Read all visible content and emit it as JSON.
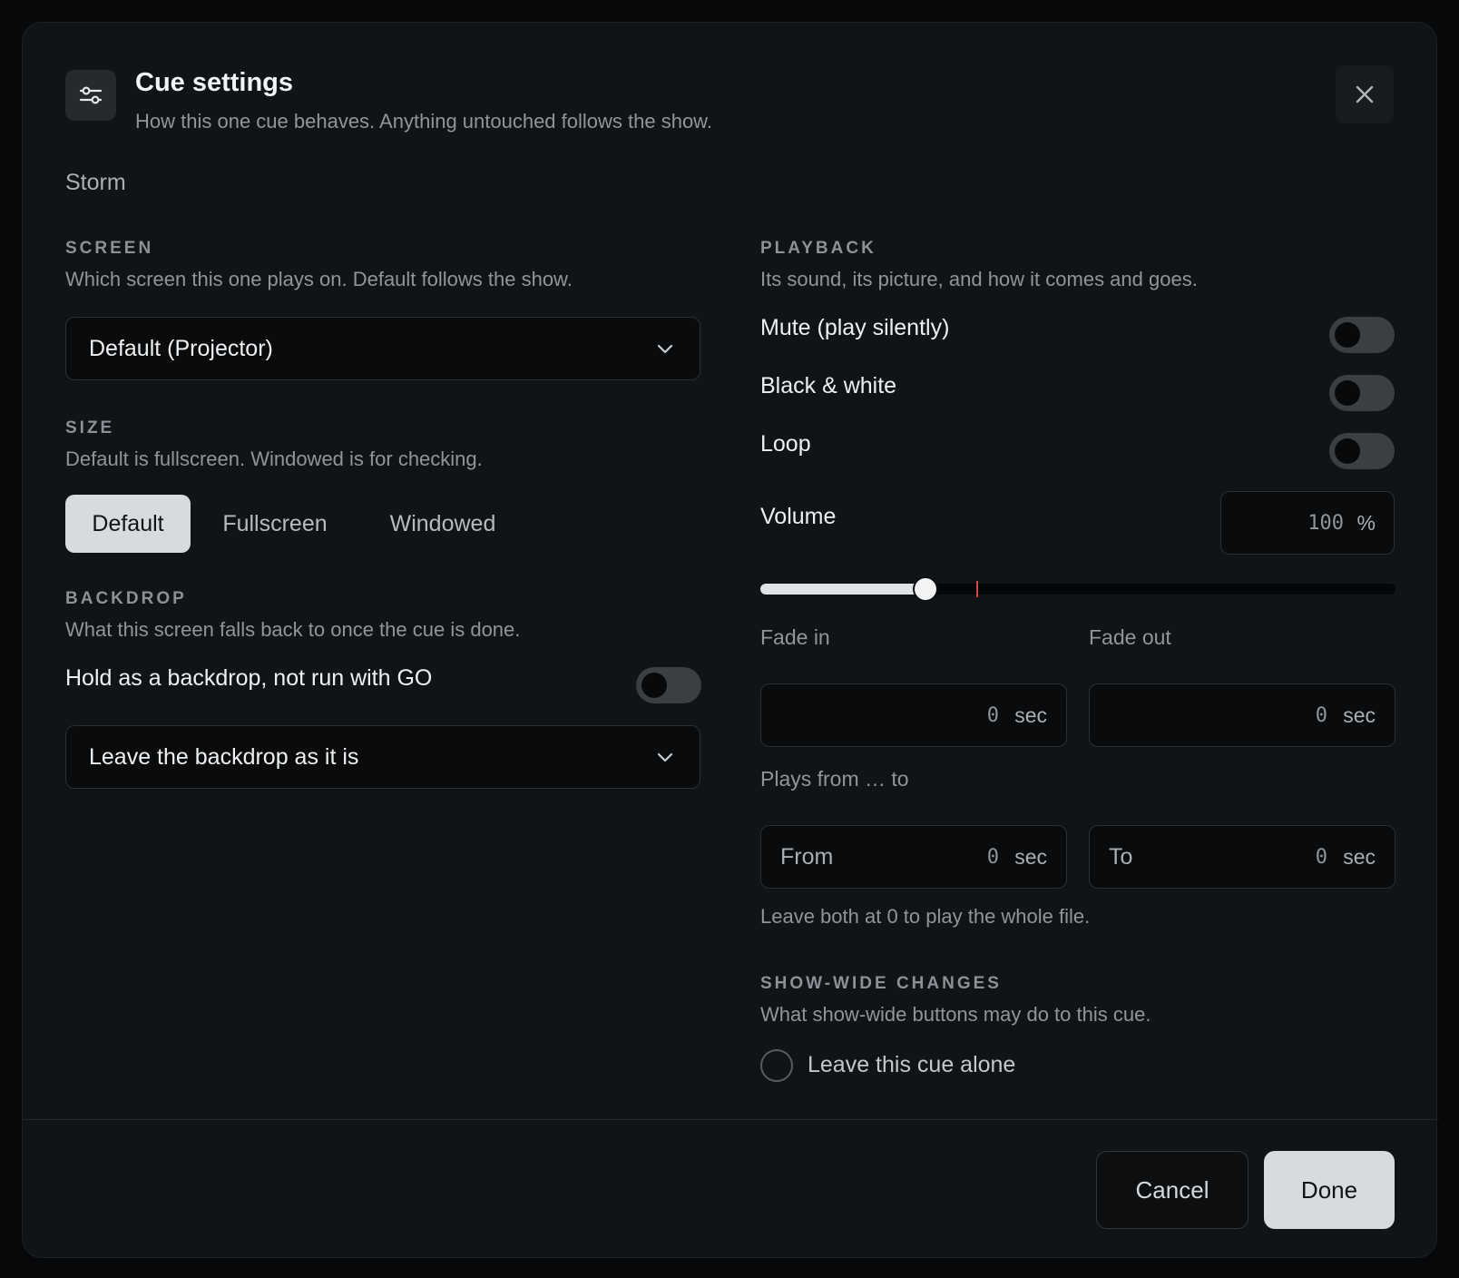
{
  "dialog": {
    "title": "Cue settings",
    "subtitle": "How this one cue behaves. Anything untouched follows the show.",
    "header_icon": "sliders-icon",
    "close_icon": "close-icon"
  },
  "cue_name": "Storm",
  "screen": {
    "label": "SCREEN",
    "help": "Which screen this one plays on. Default follows the show.",
    "selected": "Default (Projector)"
  },
  "size": {
    "label": "SIZE",
    "help": "Default is fullscreen. Windowed is for checking.",
    "options": [
      "Default",
      "Fullscreen",
      "Windowed"
    ],
    "selected": "Default"
  },
  "backdrop": {
    "label": "BACKDROP",
    "help": "What this screen falls back to once the cue is done.",
    "hold_label": "Hold as a backdrop, not run with GO",
    "hold_on": false,
    "selected": "Leave the backdrop as it is"
  },
  "playback": {
    "label": "PLAYBACK",
    "help": "Its sound, its picture, and how it comes and goes.",
    "mute_label": "Mute (play silently)",
    "mute_on": false,
    "bw_label": "Black & white",
    "bw_on": false,
    "loop_label": "Loop",
    "loop_on": false,
    "volume_label": "Volume",
    "volume_value": "100",
    "volume_unit": "%",
    "volume_slider_fraction": 0.26,
    "volume_marker_fraction": 0.34,
    "fade_in_label": "Fade in",
    "fade_in_value": "0",
    "fade_out_label": "Fade out",
    "fade_out_value": "0",
    "sec_unit": "sec",
    "range_label": "Plays from … to",
    "from_label": "From",
    "from_value": "0",
    "to_label": "To",
    "to_value": "0",
    "range_help": "Leave both at 0 to play the whole file."
  },
  "show_wide": {
    "label": "SHOW-WIDE CHANGES",
    "help": "What show-wide buttons may do to this cue.",
    "option": "Leave this cue alone",
    "checked": false
  },
  "footer": {
    "cancel": "Cancel",
    "done": "Done"
  },
  "colors": {
    "background": "#111417",
    "accent_button": "#d6dbe0",
    "volume_marker": "#d8443a"
  }
}
